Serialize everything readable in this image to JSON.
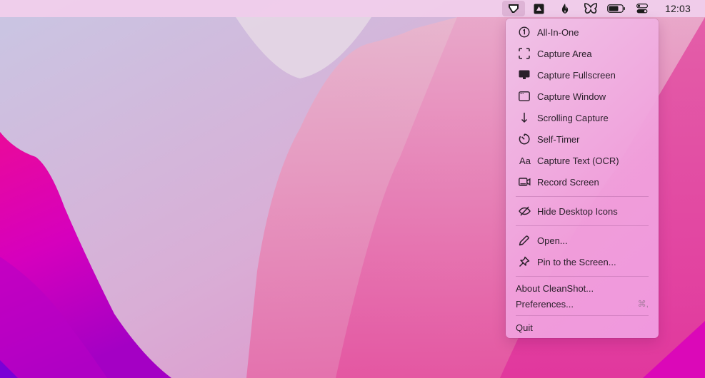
{
  "menubar": {
    "icons": [
      {
        "name": "cleanshot-icon",
        "active": true
      },
      {
        "name": "drive-icon"
      },
      {
        "name": "flame-icon"
      },
      {
        "name": "butterfly-icon"
      },
      {
        "name": "battery-icon"
      },
      {
        "name": "control-center-icon"
      }
    ],
    "clock": "12:03"
  },
  "menu": {
    "items": [
      {
        "label": "All-In-One",
        "icon": "circled-one-icon"
      },
      {
        "label": "Capture Area",
        "icon": "capture-area-icon"
      },
      {
        "label": "Capture Fullscreen",
        "icon": "display-icon"
      },
      {
        "label": "Capture Window",
        "icon": "window-icon"
      },
      {
        "label": "Scrolling Capture",
        "icon": "arrow-down-icon"
      },
      {
        "label": "Self-Timer",
        "icon": "timer-icon"
      },
      {
        "label": "Capture Text (OCR)",
        "icon": "text-aa-icon",
        "glyph": "Aa"
      },
      {
        "label": "Record Screen",
        "icon": "video-camera-icon"
      },
      {
        "label": "Hide Desktop Icons",
        "icon": "eye-slash-icon"
      },
      {
        "label": "Open...",
        "icon": "pencil-icon"
      },
      {
        "label": "Pin to the Screen...",
        "icon": "pin-icon"
      },
      {
        "label": "About CleanShot..."
      },
      {
        "label": "Preferences...",
        "shortcut": "⌘,"
      },
      {
        "label": "Quit"
      }
    ]
  }
}
